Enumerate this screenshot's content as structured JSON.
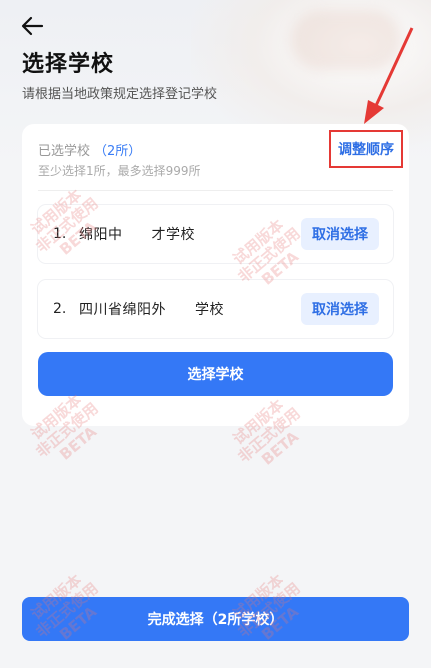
{
  "header": {
    "back_icon": "arrow-left-icon",
    "title": "选择学校",
    "subtitle": "请根据当地政策规定选择登记学校"
  },
  "selection": {
    "label": "已选学校",
    "count": "（2所）",
    "hint": "至少选择1所，最多选择999所",
    "reorder_label": "调整顺序"
  },
  "schools": [
    {
      "index": "1.",
      "name": "绵阳中　　才学校",
      "cancel_label": "取消选择"
    },
    {
      "index": "2.",
      "name": "四川省绵阳外　　学校",
      "cancel_label": "取消选择"
    }
  ],
  "choose_button": "选择学校",
  "finish_button": "完成选择（2所学校）",
  "watermark": {
    "line1": "试用版本",
    "line2": "非正式使用",
    "line3": "BETA"
  },
  "colors": {
    "accent": "#3478f6",
    "highlight_border": "#e53935"
  }
}
